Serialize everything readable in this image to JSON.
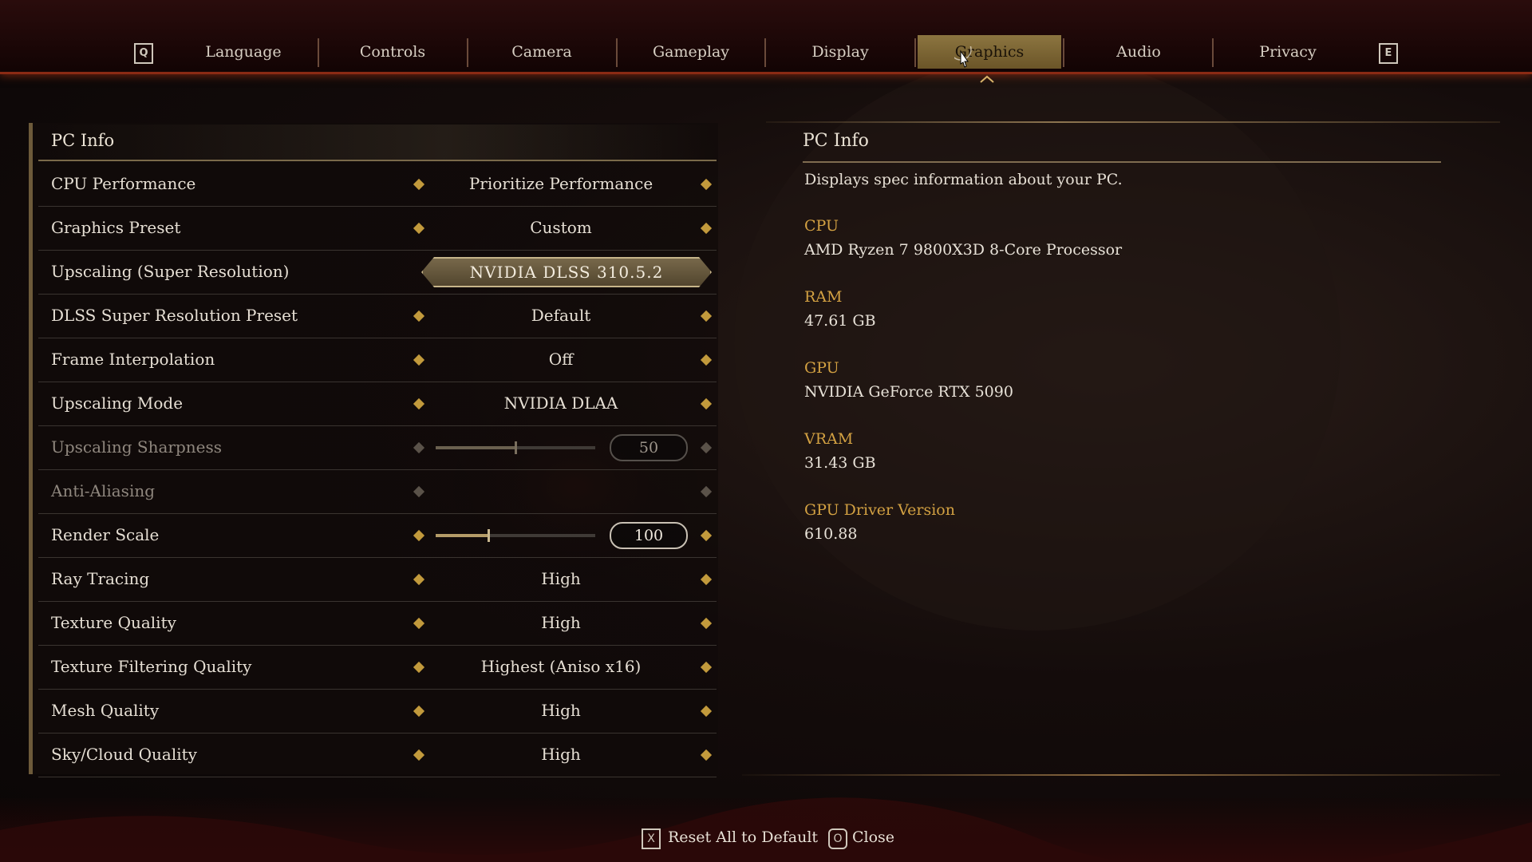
{
  "tabs": {
    "left_key": "Q",
    "right_key": "E",
    "items": [
      "Language",
      "Controls",
      "Camera",
      "Gameplay",
      "Display",
      "Graphics",
      "Audio",
      "Privacy"
    ],
    "active": "Graphics"
  },
  "settings": {
    "section_title": "PC Info",
    "rows": [
      {
        "label": "CPU Performance",
        "value": "Prioritize Performance"
      },
      {
        "label": "Graphics Preset",
        "value": "Custom"
      },
      {
        "label": "Upscaling (Super Resolution)",
        "value": "NVIDIA DLSS 310.5.2"
      },
      {
        "label": "DLSS Super Resolution Preset",
        "value": "Default"
      },
      {
        "label": "Frame Interpolation",
        "value": "Off"
      },
      {
        "label": "Upscaling Mode",
        "value": "NVIDIA DLAA"
      },
      {
        "label": "Upscaling Sharpness",
        "value": "50",
        "slider_fraction": 0.5
      },
      {
        "label": "Anti-Aliasing",
        "value": ""
      },
      {
        "label": "Render Scale",
        "value": "100",
        "slider_fraction": 0.33
      },
      {
        "label": "Ray Tracing",
        "value": "High"
      },
      {
        "label": "Texture Quality",
        "value": "High"
      },
      {
        "label": "Texture Filtering Quality",
        "value": "Highest (Aniso x16)"
      },
      {
        "label": "Mesh Quality",
        "value": "High"
      },
      {
        "label": "Sky/Cloud Quality",
        "value": "High"
      }
    ]
  },
  "info": {
    "title": "PC Info",
    "description": "Displays spec information about your PC.",
    "specs": [
      {
        "label": "CPU",
        "value": "AMD Ryzen 7 9800X3D 8-Core Processor"
      },
      {
        "label": "RAM",
        "value": "47.61 GB"
      },
      {
        "label": "GPU",
        "value": "NVIDIA GeForce RTX 5090"
      },
      {
        "label": "VRAM",
        "value": "31.43 GB"
      },
      {
        "label": "GPU Driver Version",
        "value": "610.88"
      }
    ]
  },
  "footer": {
    "reset_key": "X",
    "reset_label": "Reset All to Default",
    "close_key": "O",
    "close_label": "Close"
  },
  "colors": {
    "accent_gold": "#d3a142",
    "active_tab": "#8c7540",
    "arrow": "#c29a3c"
  }
}
